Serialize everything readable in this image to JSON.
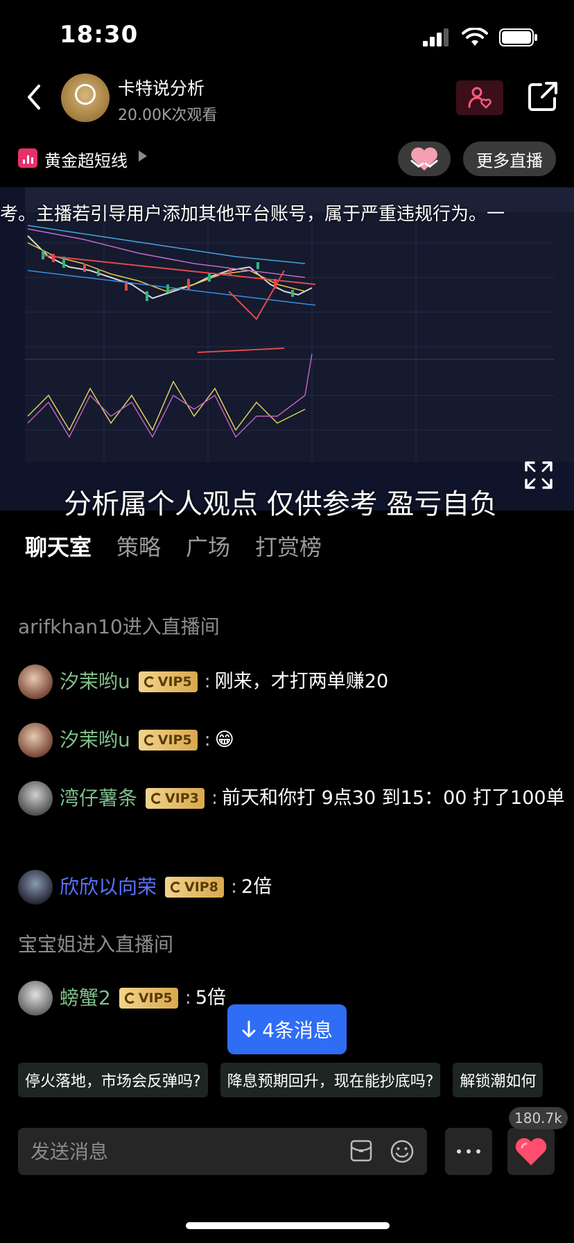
{
  "status": {
    "time": "18:30"
  },
  "header": {
    "host_name": "卡特说分析",
    "views": "20.00K次观看"
  },
  "channel": {
    "label": "黄金超短线"
  },
  "more_live": "更多直播",
  "video": {
    "marquee": "考。主播若引导用户添加其他平台账号，属于严重违规行为。一",
    "caption": "分析属个人观点 仅供参考 盈亏自负"
  },
  "tabs": [
    "聊天室",
    "策略",
    "广场",
    "打赏榜"
  ],
  "chat": {
    "sys1": "arifkhan10进入直播间",
    "m1": {
      "user": "汐茉哟u",
      "vip": "VIP5",
      "text": "刚来，才打两单赚20"
    },
    "m2": {
      "user": "汐茉哟u",
      "vip": "VIP5",
      "text": "😁"
    },
    "m3": {
      "user": "湾仔薯条",
      "vip": "VIP3",
      "text": "前天和你打 9点30 到15：00 打了100单"
    },
    "m4": {
      "user": "欣欣以向荣",
      "vip": "VIP8",
      "text": "2倍"
    },
    "sys2": "宝宝姐进入直播间",
    "m5": {
      "user": "螃蟹2",
      "vip": "VIP5",
      "text": "5倍"
    },
    "colon": ":"
  },
  "new_messages": "4条消息",
  "suggestions": [
    "停火落地，市场会反弹吗?",
    "降息预期回升，现在能抄底吗?",
    "解锁潮如何"
  ],
  "input": {
    "placeholder": "发送消息"
  },
  "like_count": "180.7k",
  "colors": {
    "accent_blue": "#2f6df5",
    "vip_gold": "#e6bd6a",
    "like_red": "#ff4d6d",
    "name_green": "#7fc08a",
    "name_blue": "#5a74ff"
  }
}
